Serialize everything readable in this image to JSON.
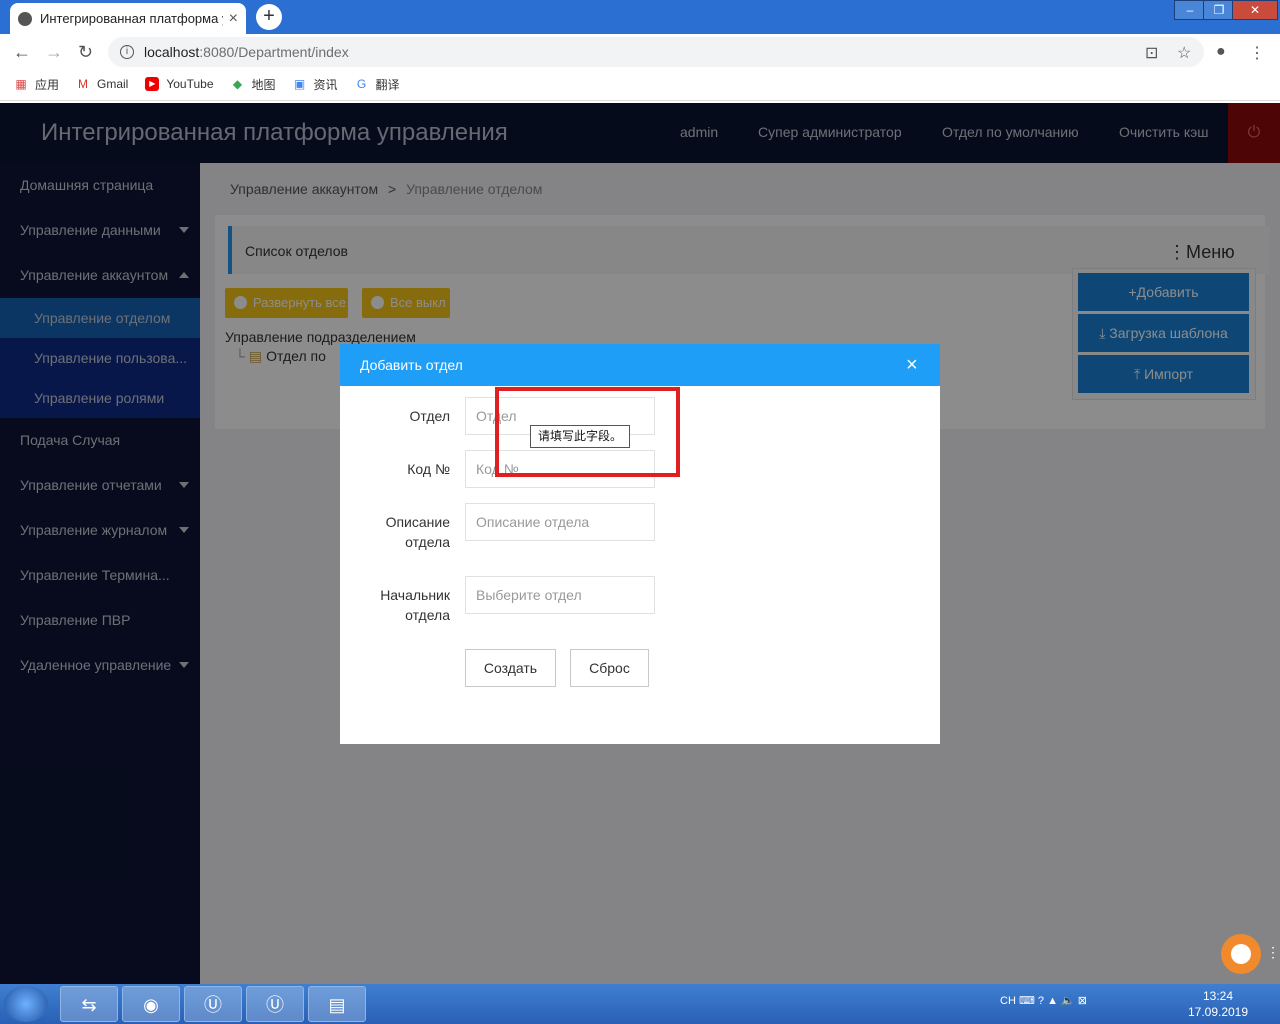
{
  "browser": {
    "tab_title": "Интегрированная платформа у",
    "tab_close": "×",
    "new_tab": "+",
    "url_host": "localhost",
    "url_path": ":8080/Department/index",
    "bookmarks": [
      {
        "label": "应用",
        "icon": "apps-grid-icon"
      },
      {
        "label": "Gmail",
        "icon": "gmail-icon"
      },
      {
        "label": "YouTube",
        "icon": "youtube-icon"
      },
      {
        "label": "地图",
        "icon": "maps-icon"
      },
      {
        "label": "资讯",
        "icon": "news-icon"
      },
      {
        "label": "翻译",
        "icon": "translate-icon"
      }
    ]
  },
  "header": {
    "title": "Интегрированная платформа управления",
    "links": [
      "admin",
      "Супер администратор",
      "Отдел по умолчанию",
      "Очистить кэш"
    ]
  },
  "sidebar": {
    "items": [
      "Домашняя страница",
      "Управление данными",
      "Управление аккаунтом",
      "Управление отделом",
      "Управление пользова...",
      "Управление ролями",
      "Подача Случая",
      "Управление отчетами",
      "Управление журналом",
      "Управление Термина...",
      "Управление ПВР",
      "Удаленное управление"
    ]
  },
  "breadcrumb": {
    "parent": "Управление аккаунтом",
    "separator": ">",
    "current": "Управление отделом"
  },
  "panel": {
    "title": "Список отделов",
    "menu_label": "⋮Меню",
    "expand_all": "Развернуть все",
    "collapse_all": "Все выкл",
    "tree_root": "Управление подразделением",
    "tree_node": "Отдел по",
    "menu_buttons": [
      "+Добавить",
      "Загрузка шаблона",
      "Импорт"
    ]
  },
  "modal": {
    "title": "Добавить отдел",
    "close": "×",
    "fields": [
      {
        "label": "Отдел",
        "placeholder": "Отдел"
      },
      {
        "label": "Код №",
        "placeholder": "Код №"
      },
      {
        "label": "Описание отдела",
        "placeholder": "Описание отдела"
      },
      {
        "label": "Начальник отдела",
        "placeholder": "Выберите отдел"
      }
    ],
    "create": "Создать",
    "reset": "Сброс",
    "validation_tooltip": "请填写此字段。"
  },
  "taskbar": {
    "lang": "CH",
    "time": "13:24",
    "date": "17.09.2019"
  },
  "colors": {
    "header_bg": "#0b1534",
    "sidebar_bg": "#0d1535",
    "active_item": "#1463b4",
    "modal_header": "#1e9ef6",
    "action_yellow": "#f5c518",
    "action_blue": "#1a82d8",
    "highlight_red": "#e02020"
  }
}
